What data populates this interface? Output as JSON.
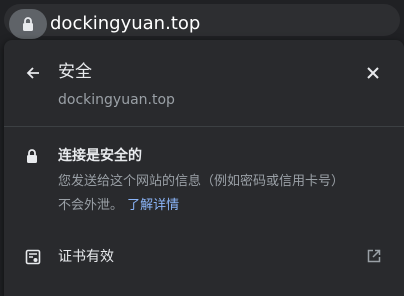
{
  "address_bar": {
    "url": "dockingyuan.top",
    "lock_icon": "lock-icon"
  },
  "security_panel": {
    "title": "安全",
    "site": "dockingyuan.top",
    "back_icon": "arrow-left-icon",
    "close_icon": "close-icon",
    "connection": {
      "icon": "lock-icon",
      "title": "连接是安全的",
      "description": "您发送给这个网站的信息（例如密码或信用卡号）不会外泄。",
      "learn_more": "了解详情"
    },
    "certificate": {
      "icon": "certificate-icon",
      "label": "证书有效",
      "external_icon": "external-link-icon"
    }
  },
  "colors": {
    "background": "#202124",
    "panel": "#292a2d",
    "text": "#e8eaed",
    "secondary_text": "#9aa0a6",
    "link": "#8ab4f8"
  }
}
